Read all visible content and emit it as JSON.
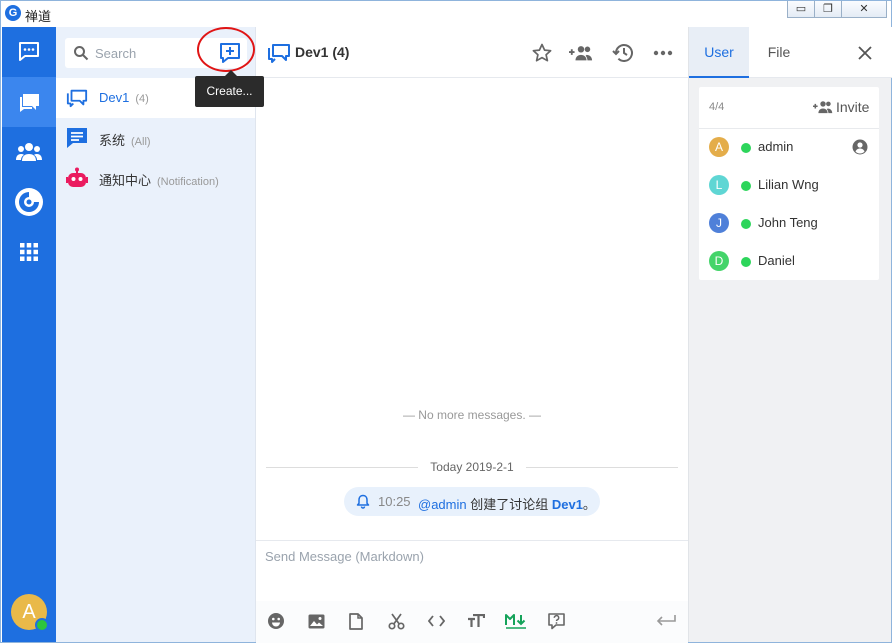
{
  "window": {
    "title": "禅道",
    "logo_glyph": "G",
    "controls": {
      "minimize": "▭",
      "restore": "❐",
      "close": "✕"
    }
  },
  "rail": {
    "items": [
      {
        "name": "chat-icon",
        "active": false
      },
      {
        "name": "chats-list-icon",
        "active": true
      },
      {
        "name": "contacts-icon",
        "active": false
      },
      {
        "name": "zentao-icon",
        "active": false
      },
      {
        "name": "apps-grid-icon",
        "active": false
      }
    ],
    "avatar_letter": "A",
    "status_color": "#2dc53e"
  },
  "listpanel": {
    "search_placeholder": "Search",
    "create_tooltip": "Create...",
    "chats": [
      {
        "name": "Dev1",
        "count": "(4)",
        "icon": "discussion-icon",
        "active": true
      },
      {
        "name": "系统",
        "count": "(All)",
        "icon": "system-channel-icon",
        "active": false
      },
      {
        "name": "通知中心",
        "count": "(Notification)",
        "icon": "robot-icon",
        "active": false
      }
    ]
  },
  "main": {
    "title": "Dev1 (4)",
    "no_more": "— No more messages. —",
    "date_label": "Today 2019-2-1",
    "system_message": {
      "time": "10:25",
      "mention": "@admin",
      "text": " 创建了讨论组 ",
      "group": "Dev1",
      "suffix": "。"
    },
    "composer_placeholder": "Send Message (Markdown)"
  },
  "rightpanel": {
    "tabs": [
      {
        "label": "User",
        "active": true
      },
      {
        "label": "File",
        "active": false
      }
    ],
    "member_count": "4/4",
    "invite_label": "Invite",
    "members": [
      {
        "initial": "A",
        "name": "admin",
        "color": "#e4ad4a",
        "is_admin": true
      },
      {
        "initial": "L",
        "name": "Lilian Wng",
        "color": "#5fd6d4",
        "is_admin": false
      },
      {
        "initial": "J",
        "name": "John Teng",
        "color": "#4f80d9",
        "is_admin": false
      },
      {
        "initial": "D",
        "name": "Daniel",
        "color": "#44d46a",
        "is_admin": false
      }
    ]
  },
  "colors": {
    "brand_blue": "#1e6fe0",
    "online_green": "#2dd55b",
    "highlight_red": "#e01515"
  }
}
